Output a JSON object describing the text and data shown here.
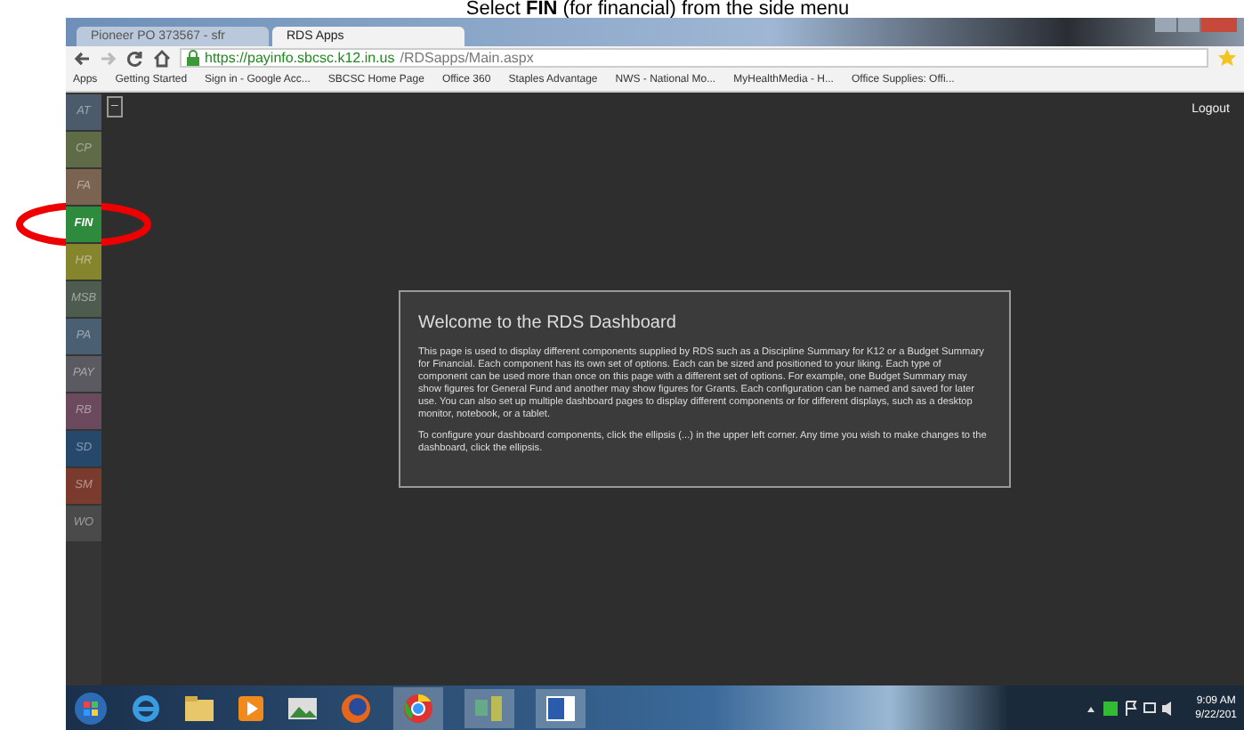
{
  "caption": "Select **FIN** (for financial) from the side menu",
  "browser": {
    "tabs": [
      {
        "label": "Pioneer PO 373567 - sfr",
        "selected": false
      },
      {
        "label": "RDS Apps",
        "selected": true
      }
    ],
    "url_host": "https://payinfo.sbcsc.k12.in.us",
    "url_path": "/RDSapps/Main.aspx",
    "bookmarks": [
      "Apps",
      "Getting Started",
      "Sign in - Google Acc...",
      "SBCSC Home Page",
      "Office 360",
      "Staples Advantage",
      "NWS - National Mo...",
      "MyHealthMedia - H...",
      "Office Supplies: Offi..."
    ]
  },
  "app": {
    "menu_button": "–",
    "logout": "Logout",
    "sidebar": [
      {
        "label": "AT",
        "color": "#4b5b6b",
        "selected": false
      },
      {
        "label": "CP",
        "color": "#5f6a47",
        "selected": false
      },
      {
        "label": "FA",
        "color": "#7a6350",
        "selected": false
      },
      {
        "label": "FIN",
        "color": "#2e8a3c",
        "selected": true
      },
      {
        "label": "HR",
        "color": "#85852e",
        "selected": false
      },
      {
        "label": "MSB",
        "color": "#4e5c50",
        "selected": false
      },
      {
        "label": "PA",
        "color": "#4a6072",
        "selected": false
      },
      {
        "label": "PAY",
        "color": "#5a5a60",
        "selected": false
      },
      {
        "label": "RB",
        "color": "#6a4a5c",
        "selected": false
      },
      {
        "label": "SD",
        "color": "#26486a",
        "selected": false
      },
      {
        "label": "SM",
        "color": "#7a3a2e",
        "selected": false
      },
      {
        "label": "WO",
        "color": "#4a4a4a",
        "selected": false
      }
    ],
    "welcome": {
      "title": "Welcome to the RDS Dashboard",
      "paragraphs": [
        "This page is used to display different components supplied by RDS such as a Discipline Summary for K12 or a Budget Summary for Financial. Each component has its own set of options. Each can be sized and positioned to your liking. Each type of component can be used more than once on this page with a different set of options. For example, one Budget Summary may show figures for General Fund and another may show figures for Grants. Each configuration can be named and saved for later use. You can also set up multiple dashboard pages to display different components or for different displays, such as a desktop monitor, notebook, or a tablet.",
        "To configure your dashboard components, click the ellipsis (...) in the upper left corner. Any time you wish to make changes to the dashboard, click the ellipsis."
      ]
    }
  },
  "taskbar": {
    "time": "9:09 AM",
    "date": "9/22/201"
  }
}
